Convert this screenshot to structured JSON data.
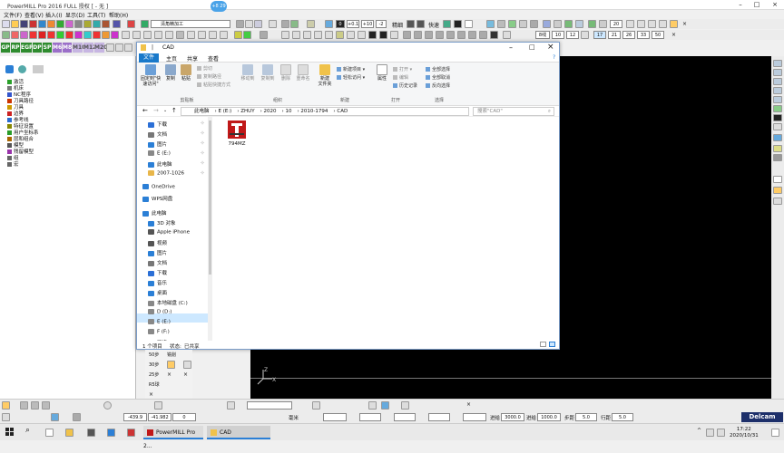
{
  "app": {
    "title": "PowerMILL Pro 2016 FULL 授权",
    "doc": "[ - 无 ]",
    "badge": "+8 29",
    "delcam": "Delcam"
  },
  "menu": [
    "文件(F)",
    "查看(V)",
    "插入(I)",
    "显示(D)",
    "工具(T)",
    "帮助(H)"
  ],
  "toolbar": {
    "combo": "清角精加工",
    "tol1": "0",
    "tol2": "+0.1",
    "tol3": "+10",
    "tol4": "-2",
    "precision": "精细",
    "fast": "快速",
    "zoom_a": "20",
    "zoom_b": "17",
    "zoom_c": "21",
    "zoom_d": "26",
    "zoom_e": "33",
    "zoom_f": "50",
    "r3a": "8线",
    "r3b": "10",
    "r3c": "12",
    "right_labels": [
      "命名",
      "AR",
      "开粗",
      "铣刀",
      "边框",
      "6",
      "侧角"
    ]
  },
  "vbuttons": [
    "GP",
    "RP",
    "EGP",
    "DP",
    "SP",
    "M6",
    "M8",
    "M10",
    "M12",
    "M20"
  ],
  "explorer_tree": [
    {
      "label": "激活",
      "color": "#2aa12a"
    },
    {
      "label": "机床",
      "color": "#7a7a7a"
    },
    {
      "label": "NC程序",
      "color": "#3355cc"
    },
    {
      "label": "刀具路径",
      "color": "#cc3300"
    },
    {
      "label": "刀具",
      "color": "#cc9900"
    },
    {
      "label": "边界",
      "color": "#cc2222"
    },
    {
      "label": "参考线",
      "color": "#2a6bd1"
    },
    {
      "label": "特征设置",
      "color": "#888800"
    },
    {
      "label": "用户坐标系",
      "color": "#2a9d2a"
    },
    {
      "label": "层和组合",
      "color": "#aa6600"
    },
    {
      "label": "模型",
      "color": "#555555"
    },
    {
      "label": "残留模型",
      "color": "#9933aa"
    },
    {
      "label": "组",
      "color": "#666666"
    },
    {
      "label": "宏",
      "color": "#666666"
    }
  ],
  "file_explorer": {
    "title": "CAD",
    "tabs": {
      "file": "文件",
      "home": "主页",
      "share": "共享",
      "view": "查看"
    },
    "ribbon": {
      "pin": "固定到\"快速访问\"",
      "copy": "复制",
      "paste": "粘贴",
      "cut": "剪切",
      "copy_path": "复制路径",
      "paste_shortcut": "粘贴快捷方式",
      "move_to": "移动到",
      "copy_to": "复制到",
      "delete": "删除",
      "rename": "重命名",
      "new_folder": "新建\n文件夹",
      "new_item": "新建项目",
      "easy_access": "轻松访问",
      "properties": "属性",
      "open": "打开",
      "edit": "编辑",
      "history": "历史记录",
      "select_all": "全部选择",
      "select_none": "全部取消",
      "invert": "反向选择",
      "groups": {
        "clipboard": "剪贴板",
        "organize": "组织",
        "new": "新建",
        "open": "打开",
        "select": "选择"
      }
    },
    "path": [
      "此电脑",
      "E (E:)",
      "ZHUY",
      "2020",
      "10",
      "2010-1794",
      "CAD"
    ],
    "search_placeholder": "搜索\"CAD\"",
    "nav": [
      {
        "label": "下载",
        "color": "#2b6fd6",
        "pin": true
      },
      {
        "label": "文档",
        "color": "#777",
        "pin": true
      },
      {
        "label": "图片",
        "color": "#2b7fd6",
        "pin": true
      },
      {
        "label": "E (E:)",
        "color": "#888",
        "pin": true
      },
      {
        "label": "此电脑",
        "color": "#2b7fd6",
        "pin": true
      },
      {
        "label": "2007-1026",
        "color": "#e8b64a",
        "pin": true
      },
      {
        "label": "OneDrive",
        "color": "#2b7fd6",
        "pin": false
      },
      {
        "label": "WPS网盘",
        "color": "#2b7fd6",
        "pin": false
      },
      {
        "label": "此电脑",
        "color": "#2b7fd6",
        "pin": false
      },
      {
        "label": "3D 对象",
        "color": "#2b7fd6",
        "pin": false
      },
      {
        "label": "Apple iPhone",
        "color": "#555",
        "pin": false
      },
      {
        "label": "视频",
        "color": "#555",
        "pin": false
      },
      {
        "label": "图片",
        "color": "#2b7fd6",
        "pin": false
      },
      {
        "label": "文档",
        "color": "#777",
        "pin": false
      },
      {
        "label": "下载",
        "color": "#2b6fd6",
        "pin": false
      },
      {
        "label": "音乐",
        "color": "#2b7fd6",
        "pin": false
      },
      {
        "label": "桌面",
        "color": "#2b7fd6",
        "pin": false
      },
      {
        "label": "本地磁盘 (C:)",
        "color": "#888",
        "pin": false
      },
      {
        "label": "D (D:)",
        "color": "#888",
        "pin": false
      },
      {
        "label": "E (E:)",
        "color": "#888",
        "pin": false
      },
      {
        "label": "F (F:)",
        "color": "#888",
        "pin": false
      },
      {
        "label": "网络",
        "color": "#2b7fd6",
        "pin": false
      }
    ],
    "files": [
      {
        "name": "794MZ"
      }
    ],
    "status": {
      "count": "1 个项目",
      "state": "状态:",
      "shared": "已共享"
    }
  },
  "bottom_tools": [
    "50步",
    "铣削",
    "30步",
    "25步",
    "R5球"
  ],
  "statusbar": {
    "x": "-439.9",
    "y": "-41.982",
    "z": "0",
    "unit": "毫米",
    "feed_label": "进给",
    "feed": "3000.0",
    "plunge_label": "进给",
    "plunge": "1000.0",
    "step_label": "步距",
    "step": "5.0",
    "row_label": "行距",
    "row": "5.0"
  },
  "taskbar": {
    "app1": "PowerMILL Pro 2...",
    "app2": "CAD",
    "time": "17:22",
    "date": "2020/10/31"
  }
}
